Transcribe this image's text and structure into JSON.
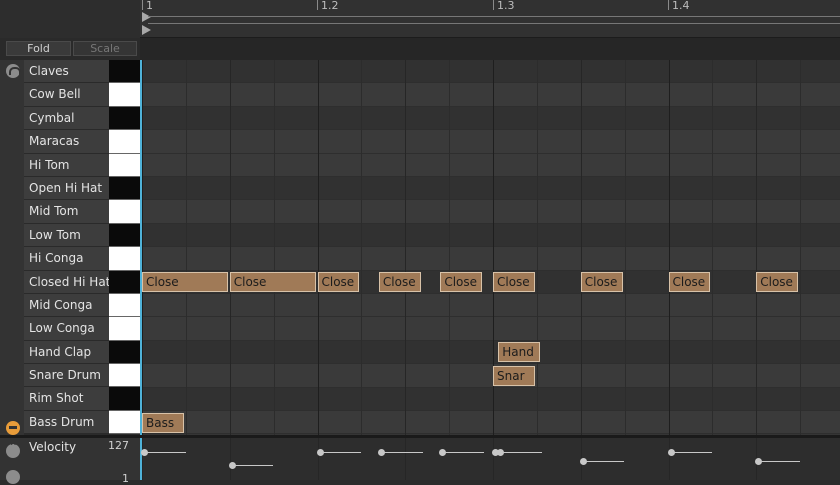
{
  "ruler": {
    "bars": [
      "1",
      "1.2",
      "1.3",
      "1.4"
    ]
  },
  "toolbar": {
    "fold_label": "Fold",
    "scale_label": "Scale"
  },
  "drums": [
    {
      "name": "Claves",
      "key": "black"
    },
    {
      "name": "Cow Bell",
      "key": "white"
    },
    {
      "name": "Cymbal",
      "key": "black"
    },
    {
      "name": "Maracas",
      "key": "white"
    },
    {
      "name": "Hi Tom",
      "key": "white"
    },
    {
      "name": "Open Hi Hat",
      "key": "black"
    },
    {
      "name": "Mid Tom",
      "key": "white"
    },
    {
      "name": "Low Tom",
      "key": "black"
    },
    {
      "name": "Hi Conga",
      "key": "white"
    },
    {
      "name": "Closed Hi Hat",
      "key": "black"
    },
    {
      "name": "Mid Conga",
      "key": "white"
    },
    {
      "name": "Low Conga",
      "key": "white"
    },
    {
      "name": "Hand Clap",
      "key": "black"
    },
    {
      "name": "Snare Drum",
      "key": "white"
    },
    {
      "name": "Rim Shot",
      "key": "black"
    },
    {
      "name": "Bass Drum",
      "key": "white"
    }
  ],
  "notes": [
    {
      "row": 9,
      "beat": 0.0,
      "length": 0.5,
      "label": "Close"
    },
    {
      "row": 9,
      "beat": 0.5,
      "length": 0.5,
      "label": "Close"
    },
    {
      "row": 9,
      "beat": 1.0,
      "length": 0.25,
      "label": "Close"
    },
    {
      "row": 9,
      "beat": 1.35,
      "length": 0.25,
      "label": "Close"
    },
    {
      "row": 9,
      "beat": 1.7,
      "length": 0.25,
      "label": "Close"
    },
    {
      "row": 9,
      "beat": 2.0,
      "length": 0.25,
      "label": "Close"
    },
    {
      "row": 9,
      "beat": 2.5,
      "length": 0.25,
      "label": "Close"
    },
    {
      "row": 9,
      "beat": 3.0,
      "length": 0.25,
      "label": "Close"
    },
    {
      "row": 9,
      "beat": 3.5,
      "length": 0.25,
      "label": "Close"
    },
    {
      "row": 12,
      "beat": 2.03,
      "length": 0.25,
      "label": "Hand"
    },
    {
      "row": 13,
      "beat": 2.0,
      "length": 0.25,
      "label": "Snar"
    },
    {
      "row": 15,
      "beat": 0.0,
      "length": 0.25,
      "label": "Bass"
    }
  ],
  "velocity": {
    "label": "Velocity",
    "max": "127",
    "min": "1",
    "points": [
      {
        "beat": 0.0,
        "value": 0.85,
        "length": 0.25
      },
      {
        "beat": 0.5,
        "value": 0.55,
        "length": 0.25
      },
      {
        "beat": 1.0,
        "value": 0.85,
        "length": 0.25
      },
      {
        "beat": 1.35,
        "value": 0.85,
        "length": 0.25
      },
      {
        "beat": 1.7,
        "value": 0.85,
        "length": 0.25
      },
      {
        "beat": 2.0,
        "value": 0.85,
        "length": 0.25
      },
      {
        "beat": 2.03,
        "value": 0.85,
        "length": 0.25
      },
      {
        "beat": 2.5,
        "value": 0.65,
        "length": 0.25
      },
      {
        "beat": 3.0,
        "value": 0.85,
        "length": 0.25
      },
      {
        "beat": 3.5,
        "value": 0.65,
        "length": 0.25
      }
    ]
  }
}
